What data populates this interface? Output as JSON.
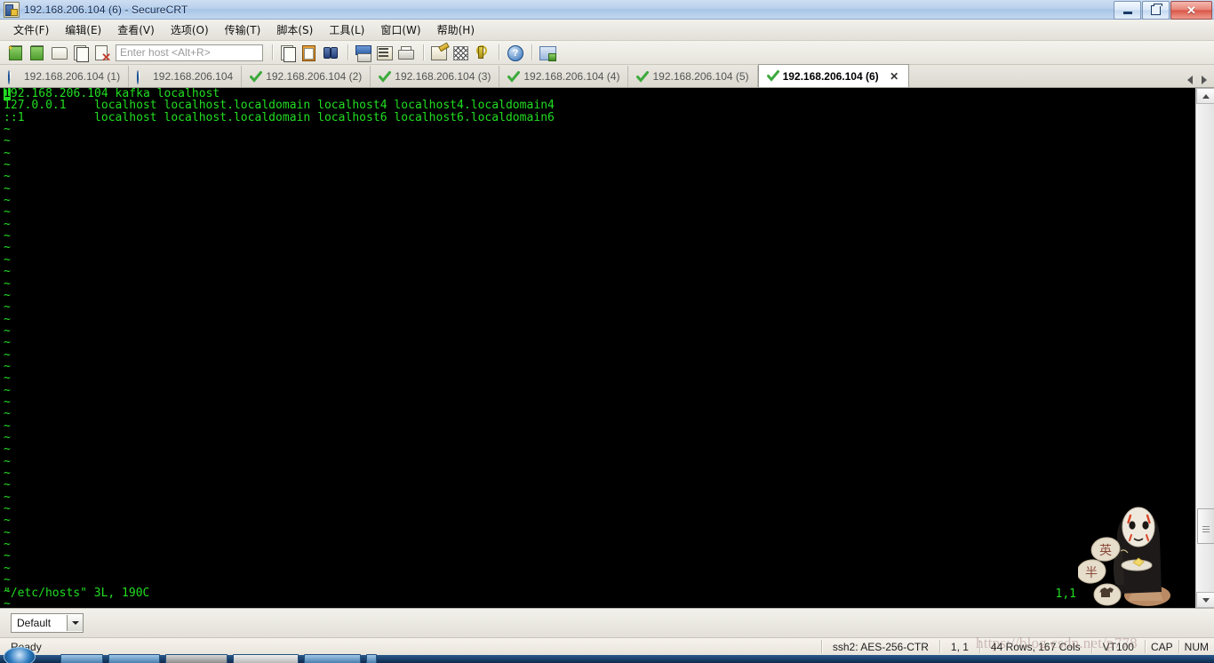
{
  "window": {
    "title": "192.168.206.104 (6) - SecureCRT",
    "app_icon": "securecrt-icon",
    "minimize_label": "",
    "restore_label": "",
    "close_label": "✕"
  },
  "menu": {
    "items": [
      {
        "label": "文件(F)",
        "name": "menu-file"
      },
      {
        "label": "编辑(E)",
        "name": "menu-edit"
      },
      {
        "label": "查看(V)",
        "name": "menu-view"
      },
      {
        "label": "选项(O)",
        "name": "menu-options"
      },
      {
        "label": "传输(T)",
        "name": "menu-transfer"
      },
      {
        "label": "脚本(S)",
        "name": "menu-script"
      },
      {
        "label": "工具(L)",
        "name": "menu-tools"
      },
      {
        "label": "窗口(W)",
        "name": "menu-window"
      },
      {
        "label": "帮助(H)",
        "name": "menu-help"
      }
    ]
  },
  "toolbar": {
    "host_input": {
      "value": "",
      "placeholder": "Enter host <Alt+R>"
    },
    "icons": [
      "new-session-icon",
      "connect-sftp-icon",
      "connect-local-shell-icon",
      "reconnect-icon",
      "disconnect-icon",
      "copy-icon",
      "paste-icon",
      "find-icon",
      "print-screen-icon",
      "log-session-icon",
      "print-icon",
      "session-options-icon",
      "toggle-raw-icon",
      "key-icon",
      "help-icon",
      "window-tile-icon"
    ]
  },
  "tabs": {
    "items": [
      {
        "label": "192.168.206.104 (1)",
        "icon": "info-icon",
        "active": false
      },
      {
        "label": "192.168.206.104",
        "icon": "info-icon",
        "active": false
      },
      {
        "label": "192.168.206.104 (2)",
        "icon": "check-icon",
        "active": false
      },
      {
        "label": "192.168.206.104 (3)",
        "icon": "check-icon",
        "active": false
      },
      {
        "label": "192.168.206.104 (4)",
        "icon": "check-icon",
        "active": false
      },
      {
        "label": "192.168.206.104 (5)",
        "icon": "check-icon",
        "active": false
      },
      {
        "label": "192.168.206.104 (6)",
        "icon": "check-icon",
        "active": true
      }
    ],
    "close_label": "✕",
    "scroll_left": "◁",
    "scroll_right": "▷"
  },
  "terminal": {
    "lines": [
      {
        "cursor": "1",
        "text": "92.168.206.104 kafka localhost"
      },
      {
        "cursor": "",
        "text": "127.0.0.1    localhost localhost.localdomain localhost4 localhost4.localdomain4"
      },
      {
        "cursor": "",
        "text": "::1          localhost localhost.localdomain localhost6 localhost6.localdomain6"
      }
    ],
    "empty_marker": "~",
    "empty_marker_count": 41,
    "status_line": "\"/etc/hosts\" 3L, 190C",
    "cursor_position": "1,1",
    "fg_color": "#22dd22",
    "bg_color": "#000000"
  },
  "session_bar": {
    "profile": "Default",
    "dropdown_glyph": "▼"
  },
  "status_bar": {
    "ready": "Ready",
    "cipher": "ssh2: AES-256-CTR",
    "position": "1,  1",
    "size": "44 Rows, 167 Cols",
    "emulation": "VT100",
    "caps": "CAP",
    "num": "NUM"
  },
  "watermark": {
    "text": "https://blog.csdn.net/p778"
  },
  "colors": {
    "terminal_green": "#22dd22",
    "terminal_bg": "#000000",
    "tab_active_bg": "#ffffff",
    "titlebar_accent": "#a8c4e6",
    "close_button_red": "#d9574a"
  }
}
